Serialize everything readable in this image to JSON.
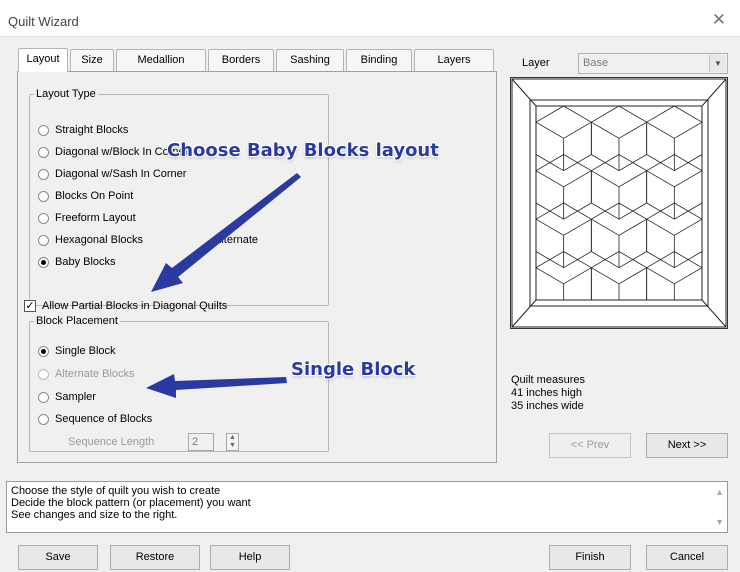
{
  "window": {
    "title": "Quilt Wizard",
    "close_glyph": "✕"
  },
  "tabs": [
    {
      "label": "Layout"
    },
    {
      "label": "Size"
    },
    {
      "label": "Medallion"
    },
    {
      "label": "Borders"
    },
    {
      "label": "Sashing"
    },
    {
      "label": "Binding"
    },
    {
      "label": "Layers"
    }
  ],
  "layout_type": {
    "legend": "Layout Type",
    "options": [
      {
        "label": "Straight Blocks",
        "selected": false
      },
      {
        "label": "Diagonal w/Block In Corner",
        "selected": false
      },
      {
        "label": "Diagonal w/Sash In Corner",
        "selected": false
      },
      {
        "label": "Blocks On Point",
        "selected": false
      },
      {
        "label": "Freeform Layout",
        "selected": false
      },
      {
        "label": "Hexagonal Blocks",
        "selected": false
      },
      {
        "label": "Baby Blocks",
        "selected": true
      }
    ],
    "alternate_label": "Alternate"
  },
  "partial_blocks": {
    "label": "Allow Partial Blocks in Diagonal Quilts",
    "checked": true,
    "check_glyph": "✓"
  },
  "block_placement": {
    "legend": "Block Placement",
    "options": [
      {
        "label": "Single Block",
        "selected": true,
        "enabled": true
      },
      {
        "label": "Alternate Blocks",
        "selected": false,
        "enabled": false
      },
      {
        "label": "Sampler",
        "selected": false,
        "enabled": true
      },
      {
        "label": "Sequence of Blocks",
        "selected": false,
        "enabled": true
      }
    ],
    "sequence_length": {
      "label": "Sequence Length",
      "value": "2"
    }
  },
  "callouts": {
    "baby_blocks": "Choose Baby Blocks layout",
    "single_block": "Single Block",
    "arrow_color": "#2a3aa0"
  },
  "layer": {
    "label": "Layer",
    "value": "Base"
  },
  "quilt_info": {
    "line1": "Quilt measures",
    "line2": "41 inches high",
    "line3": "35 inches wide"
  },
  "nav": {
    "prev": "<< Prev",
    "next": "Next >>"
  },
  "help_text": {
    "line1": "Choose the style of quilt you wish to create",
    "line2": "Decide the block pattern (or placement) you want",
    "line3": "See changes and size to the right."
  },
  "footer": {
    "save": "Save",
    "restore": "Restore",
    "help": "Help",
    "finish": "Finish",
    "cancel": "Cancel"
  }
}
